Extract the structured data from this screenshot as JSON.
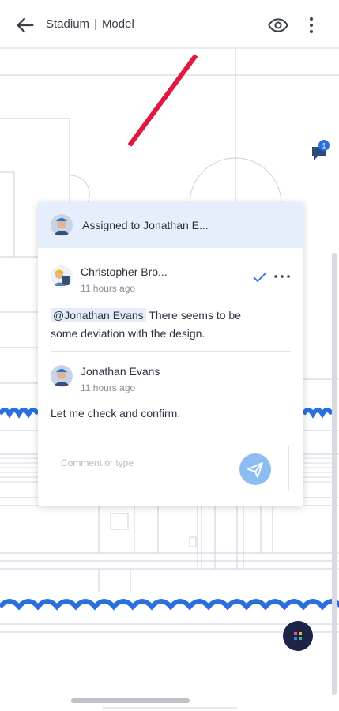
{
  "header": {
    "project": "Stadium",
    "separator": "|",
    "view": "Model"
  },
  "comment_badge": {
    "count": "1"
  },
  "card": {
    "assigned_prefix": "Assigned to",
    "assigned_name": "Jonathan E...",
    "messages": [
      {
        "author": "Christopher Bro...",
        "time": "11 hours ago",
        "mention": "@Jonathan Evans",
        "text": "There seems to be some deviation with the design."
      },
      {
        "author": "Jonathan Evans",
        "time": "11 hours ago",
        "text": "Let me check and confirm."
      }
    ],
    "input_placeholder": "Comment or type"
  },
  "colors": {
    "accent": "#3f7fe0",
    "markup_red": "#e0173f",
    "cloud_blue": "#2a6fe0",
    "fab": "#1d2447",
    "send": "#8dbcf0"
  }
}
